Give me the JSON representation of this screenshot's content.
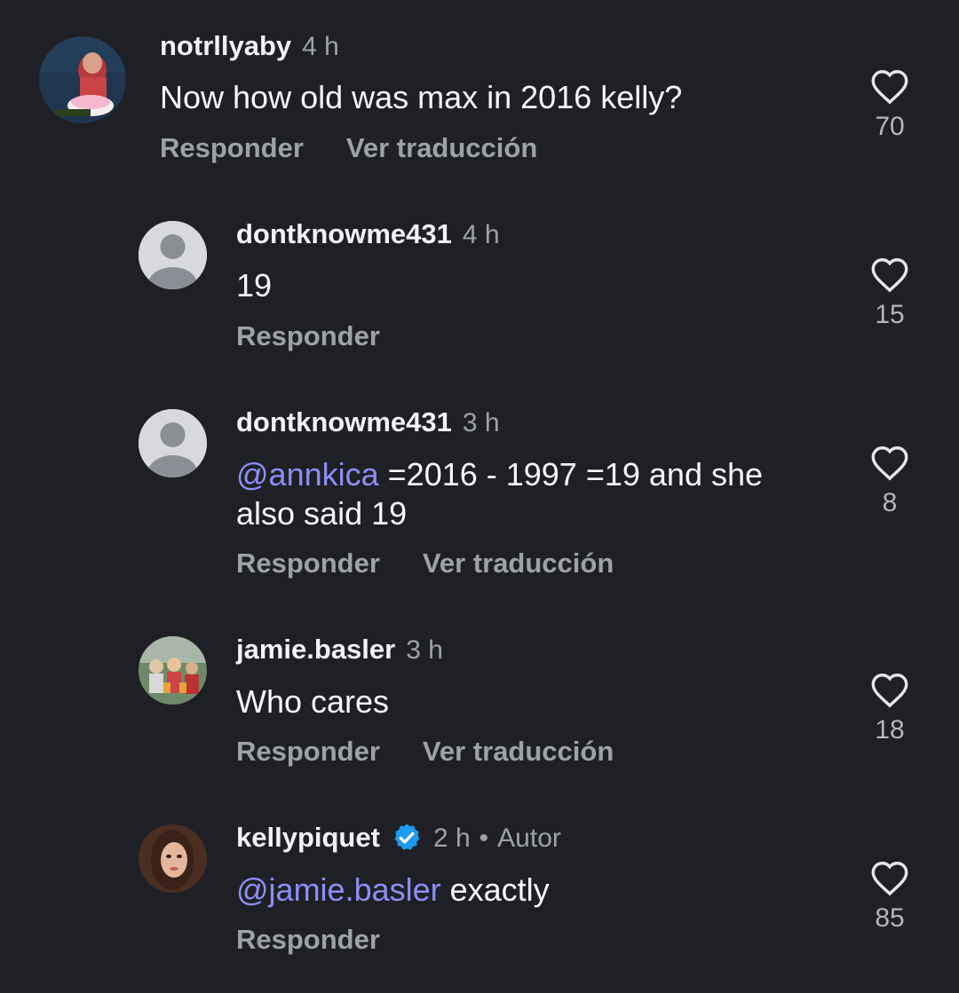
{
  "actions": {
    "reply": "Responder",
    "translate": "Ver traducción"
  },
  "comments": [
    {
      "username": "notrllyaby",
      "time": "4 h",
      "text": "Now how old was max in 2016 kelly?",
      "likes": "70",
      "avatar": "photo-cake"
    },
    {
      "username": "dontknowme431",
      "time": "4 h",
      "text": "19",
      "likes": "15",
      "avatar": "default-user-icon"
    },
    {
      "username": "dontknowme431",
      "time": "3 h",
      "mention": "@annkica",
      "text": " =2016 - 1997 =19 and she also said 19",
      "likes": "8",
      "avatar": "default-user-icon"
    },
    {
      "username": "jamie.basler",
      "time": "3 h",
      "text": "Who cares",
      "likes": "18",
      "avatar": "photo-group"
    },
    {
      "username": "kellypiquet",
      "time": "2 h",
      "badge": "Autor",
      "mention": "@jamie.basler",
      "text": " exactly",
      "likes": "85",
      "avatar": "photo-portrait",
      "verified": true
    }
  ],
  "colors": {
    "background": "#1f2025",
    "mention": "#8c8ff5",
    "secondary_text": "#9ea2a8",
    "verified": "#1d9bf0"
  }
}
